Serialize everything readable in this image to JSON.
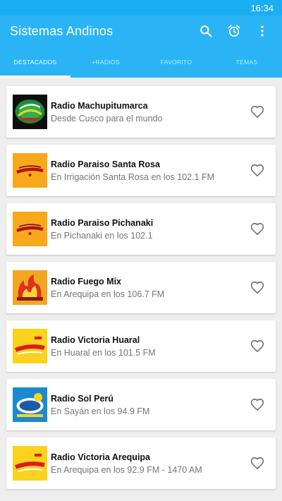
{
  "status": {
    "time": "16:34"
  },
  "app": {
    "title": "Sistemas Andinos",
    "colors": {
      "primary": "#2ab4f5",
      "status_bar": "#1aaef2",
      "background": "#eeeeee"
    },
    "actions": [
      {
        "icon": "search-icon"
      },
      {
        "icon": "alarm-clock-icon"
      },
      {
        "icon": "more-vertical-icon"
      }
    ]
  },
  "tabs": [
    {
      "label": "DESTACADOS",
      "active": true
    },
    {
      "label": "+RADIOS",
      "active": false
    },
    {
      "label": "FAVORITO",
      "active": false
    },
    {
      "label": "TEMAS",
      "active": false
    }
  ],
  "stations": [
    {
      "name": "Radio Machupitumarca",
      "subtitle": "Desde Cusco para el mundo",
      "logo": "machupitumarca-logo",
      "favorite": false
    },
    {
      "name": "Radio Paraiso Santa Rosa",
      "subtitle": "En Irrigación Santa Rosa en los 102.1 FM",
      "logo": "paraiso-logo",
      "favorite": false
    },
    {
      "name": "Radio Paraiso Pichanaki",
      "subtitle": "En Pichanaki en los 102.1",
      "logo": "paraiso-logo",
      "favorite": false
    },
    {
      "name": "Radio Fuego Mix",
      "subtitle": "En Arequipa en los 106.7 FM",
      "logo": "fuego-mix-logo",
      "favorite": false
    },
    {
      "name": "Radio Victoria Huaral",
      "subtitle": "En Huaral en los 101.5 FM",
      "logo": "victoria-logo",
      "favorite": false
    },
    {
      "name": "Radio Sol Perú",
      "subtitle": "En Sayán en los 94.9 FM",
      "logo": "sol-peru-logo",
      "favorite": false
    },
    {
      "name": "Radio Victoria Arequipa",
      "subtitle": "En Arequipa en los 92.9 FM - 1470 AM",
      "logo": "victoria-logo",
      "favorite": false
    }
  ]
}
